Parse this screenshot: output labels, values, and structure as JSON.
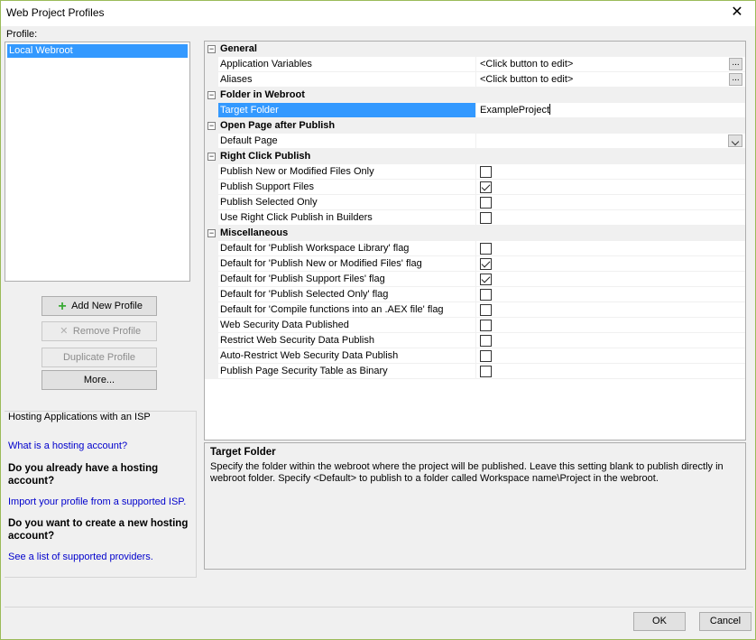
{
  "window": {
    "title": "Web Project Profiles",
    "close_glyph": "✕"
  },
  "profile": {
    "label": "Profile:",
    "items": [
      "Local Webroot"
    ]
  },
  "buttons": {
    "add": "Add New Profile",
    "remove": "Remove Profile",
    "duplicate": "Duplicate Profile",
    "more": "More..."
  },
  "hosting": {
    "title": "Hosting Applications with an ISP",
    "link1": "What is a hosting account?",
    "q1": "Do you already have a hosting account?",
    "link2": "Import your profile from a supported ISP.",
    "q2": "Do you want to create a new hosting account?",
    "link3": "See a list of supported providers."
  },
  "grid": {
    "toggle_glyph": "−",
    "ellipsis_glyph": "...",
    "general": {
      "title": "General",
      "rows": [
        {
          "name": "Application Variables",
          "value": "<Click button to edit>"
        },
        {
          "name": "Aliases",
          "value": "<Click button to edit>"
        }
      ]
    },
    "folder": {
      "title": "Folder in Webroot",
      "rows": [
        {
          "name": "Target Folder",
          "value": "ExampleProject"
        }
      ]
    },
    "open_page": {
      "title": "Open Page after Publish",
      "rows": [
        {
          "name": "Default Page",
          "value": ""
        }
      ]
    },
    "right_click": {
      "title": "Right Click Publish",
      "rows": [
        {
          "name": "Publish New or Modified Files Only",
          "checked": false
        },
        {
          "name": "Publish Support Files",
          "checked": true
        },
        {
          "name": "Publish Selected Only",
          "checked": false
        },
        {
          "name": "Use Right Click Publish in Builders",
          "checked": false
        }
      ]
    },
    "misc": {
      "title": "Miscellaneous",
      "rows": [
        {
          "name": "Default for 'Publish Workspace Library' flag",
          "checked": false
        },
        {
          "name": "Default for 'Publish New or Modified Files' flag",
          "checked": true
        },
        {
          "name": "Default for 'Publish Support Files' flag",
          "checked": true
        },
        {
          "name": "Default for 'Publish Selected Only' flag",
          "checked": false
        },
        {
          "name": "Default for 'Compile functions into an .AEX file' flag",
          "checked": false
        },
        {
          "name": "Web Security Data Published",
          "checked": false
        },
        {
          "name": "Restrict Web Security Data Publish",
          "checked": false
        },
        {
          "name": "Auto-Restrict Web Security Data Publish",
          "checked": false
        },
        {
          "name": "Publish Page Security Table as Binary",
          "checked": false
        }
      ]
    }
  },
  "description": {
    "title": "Target Folder",
    "text": "Specify the folder within the webroot where the project will be published. Leave this setting blank to publish directly in webroot folder. Specify <Default> to publish to a folder called Workspace name\\Project in the webroot."
  },
  "footer": {
    "ok": "OK",
    "cancel": "Cancel"
  }
}
